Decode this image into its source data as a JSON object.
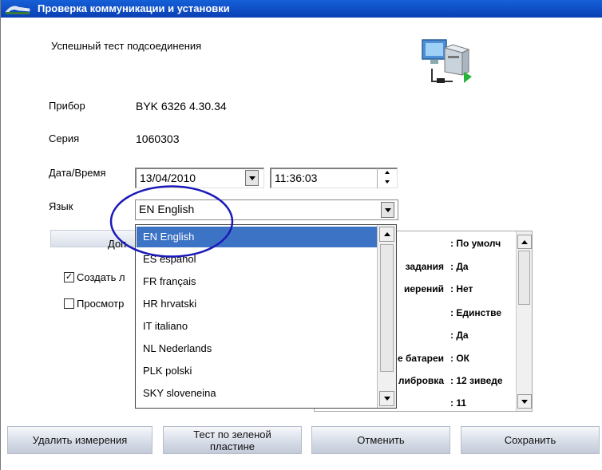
{
  "window": {
    "title": "Проверка коммуникации и установки"
  },
  "status_text": "Успешный тест подсоединения",
  "fields": {
    "device_label": "Прибор",
    "device_value": "BYK 6326 4.30.34",
    "serial_label": "Серия",
    "serial_value": "1060303",
    "datetime_label": "Дата/Время",
    "date_value": "13/04/2010",
    "time_value": "11:36:03",
    "language_label": "Язык",
    "language_value": "EN English"
  },
  "more_button": {
    "label": "Доп"
  },
  "checkboxes": [
    {
      "label": "Создать л",
      "checked": true,
      "mark": "✓"
    },
    {
      "label": "Просмотр",
      "checked": false,
      "mark": ""
    }
  ],
  "language_options": [
    "EN English",
    "ES español",
    "FR français",
    "HR hrvatski",
    "IT italiano",
    "NL Nederlands",
    "PLK polski",
    "SKY sloveneina"
  ],
  "selected_language_index": 0,
  "details": [
    {
      "key": "",
      "value": ": По умолч"
    },
    {
      "key": "задания",
      "value": ": Да"
    },
    {
      "key": "иерений",
      "value": ": Нет"
    },
    {
      "key": "",
      "value": ": Единстве"
    },
    {
      "key": "",
      "value": ": Да"
    },
    {
      "key": "е батареи",
      "value": ": ОК"
    },
    {
      "key": "либровка",
      "value": ": 12 зиведе"
    },
    {
      "key": "",
      "value": ": 11"
    }
  ],
  "buttons": {
    "delete": "Удалить измерения",
    "green_test_line1": "Тест по зеленой",
    "green_test_line2": "пластине",
    "cancel": "Отменить",
    "save": "Сохранить"
  },
  "colors": {
    "titlebar": "#0a3fb4",
    "selection": "#3d73c4",
    "annotation_ellipse": "#1a1ab8"
  },
  "icons": {
    "title": "app-icon",
    "computer": "computer-network-icon",
    "dropdown": "chevron-down-icon",
    "spin_up": "spin-up-icon",
    "spin_down": "spin-down-icon"
  }
}
